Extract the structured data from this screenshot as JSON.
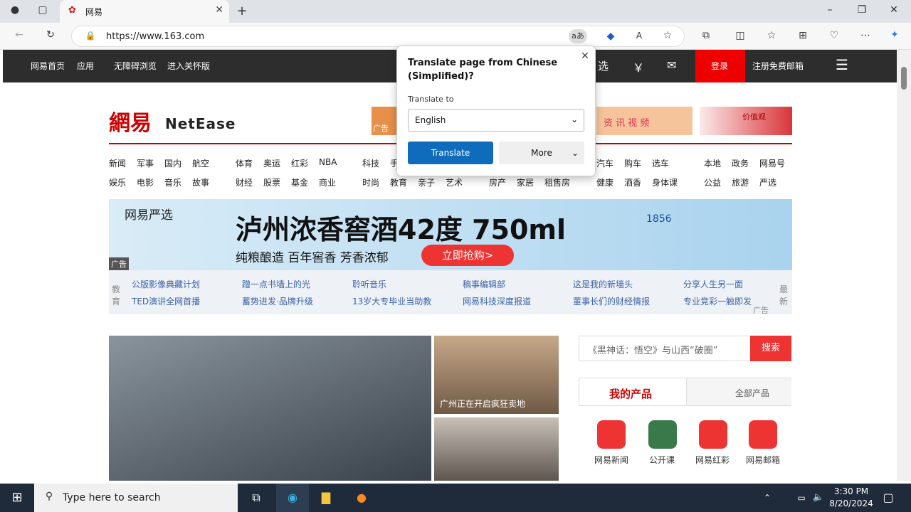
{
  "browser": {
    "tab_title": "网易",
    "url": "https://www.163.com"
  },
  "topnav": {
    "items": [
      "网易首页",
      "应用",
      "无障碍浏览",
      "进入关怀版"
    ],
    "right_items": [
      "选",
      "￥",
      "✉"
    ],
    "login": "登录",
    "register": "注册免费邮箱"
  },
  "header": {
    "logo_cn": "網易",
    "logo_en": "NetEase",
    "ad_label": "广告",
    "ad_text": "资 讯 视 频",
    "ad2_text": "价值观"
  },
  "categories": [
    [
      "新闻",
      "军事",
      "国内",
      "航空",
      "体育",
      "奥运",
      "红彩",
      "NBA",
      "科技",
      "手",
      "汽车",
      "购车",
      "选车",
      "本地",
      "政务",
      "网易号"
    ],
    [
      "娱乐",
      "电影",
      "音乐",
      "故事",
      "财经",
      "股票",
      "基金",
      "商业",
      "时尚",
      "教育",
      "亲子",
      "艺术",
      "房产",
      "家居",
      "租售房",
      "健康",
      "酒香",
      "身体课",
      "公益",
      "旅游",
      "严选"
    ]
  ],
  "banner": {
    "brand": "网易严选",
    "headline": "泸州浓香窖酒42度 750ml",
    "sub": "纯粮酿造 百年窖香 芳香浓郁",
    "cta": "立即抢购>",
    "ad": "广告",
    "badge": "1856"
  },
  "linkrow": {
    "left": "教育",
    "right": "最新",
    "ad": "广告",
    "links": [
      "公版影像典藏计划",
      "蹭一点书墙上的光",
      "聆听音乐",
      "稿事编辑部",
      "这是我的新墙头",
      "分享人生另一面",
      "TED演讲全网首播",
      "蓄势进发·品牌升级",
      "13岁大专毕业当助教",
      "网易科技深度报道",
      "董事长们的财经情报",
      "专业竞彩一触即发"
    ]
  },
  "news": {
    "caption1": "广州正在开启疯狂卖地"
  },
  "search": {
    "placeholder": "《黑神话：悟空》与山西“破圈”",
    "button": "搜索"
  },
  "products": {
    "tab_active": "我的产品",
    "tab_other": "全部产品",
    "items": [
      "网易新闻",
      "公开课",
      "网易红彩",
      "网易邮箱"
    ]
  },
  "translate_popup": {
    "title": "Translate page from Chinese (Simplified)?",
    "label": "Translate to",
    "language": "English",
    "translate": "Translate",
    "more": "More"
  },
  "taskbar": {
    "search_placeholder": "Type here to search",
    "time": "3:30 PM",
    "date": "8/20/2024"
  },
  "colors": {
    "accent": "#e00000",
    "translate_blue": "#0f6cbd"
  }
}
